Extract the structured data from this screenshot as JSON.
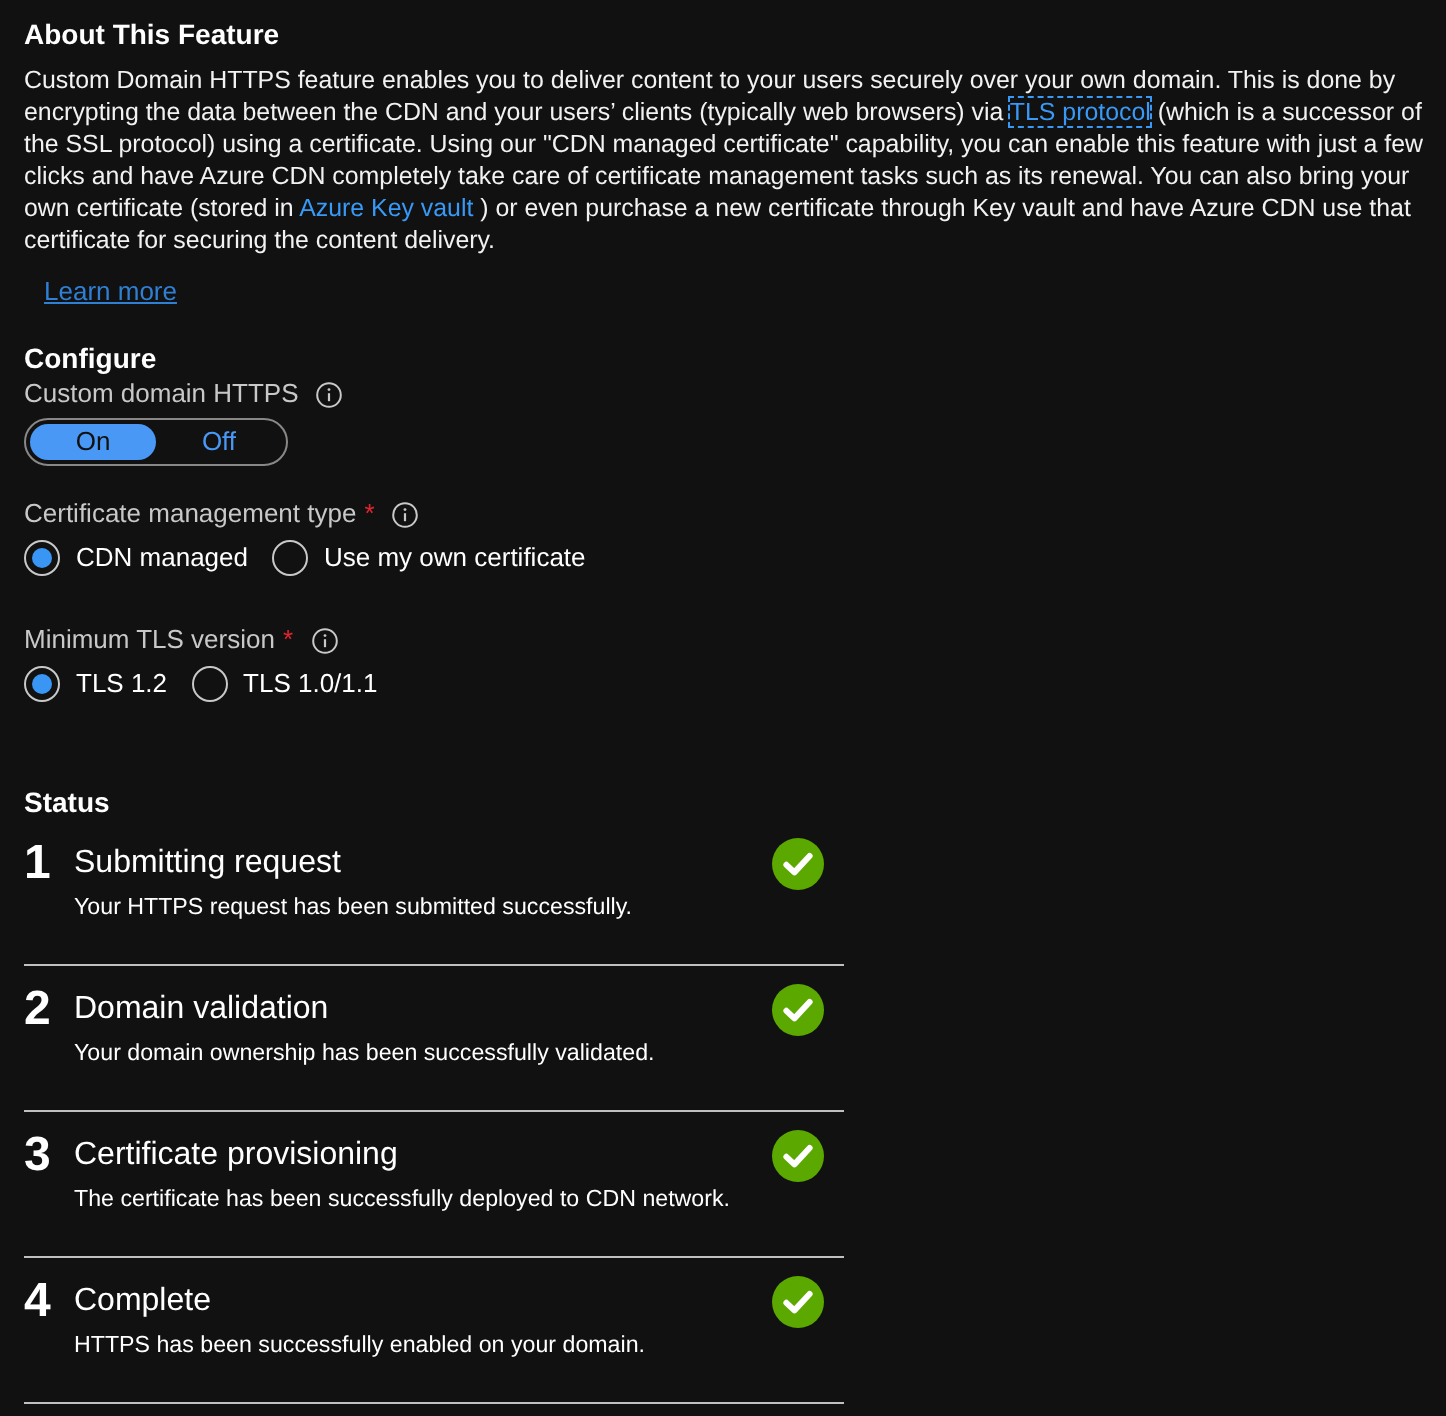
{
  "about": {
    "title": "About This Feature",
    "paragraph": [
      {
        "kind": "text",
        "text": "Custom Domain HTTPS feature enables you to deliver content to your users securely over your own domain. This is done by encrypting the data between the CDN and your users’ clients (typically web browsers) via "
      },
      {
        "kind": "link",
        "text": "TLS protocol",
        "focused": true
      },
      {
        "kind": "text",
        "text": " (which is a successor of the SSL protocol) using a certificate. Using our \"CDN managed certificate\" capability, you can enable this feature with just a few clicks and have Azure CDN completely take care of certificate management tasks such as its renewal. You can also bring your own certificate (stored in "
      },
      {
        "kind": "link",
        "text": "Azure Key vault",
        "focused": false
      },
      {
        "kind": "text",
        "text": " ) or even purchase a new certificate through Key vault and have Azure CDN use that certificate for securing the content delivery."
      }
    ],
    "learn_more": "Learn more"
  },
  "configure": {
    "title": "Configure",
    "fields": [
      {
        "kind": "toggle",
        "label": "Custom domain HTTPS",
        "info": true,
        "options": [
          {
            "label": "On",
            "selected": true
          },
          {
            "label": "Off",
            "selected": false
          }
        ]
      },
      {
        "kind": "radio",
        "label": "Certificate management type",
        "required_mark": "*",
        "info": true,
        "options": [
          {
            "label": "CDN managed",
            "selected": true
          },
          {
            "label": "Use my own certificate",
            "selected": false
          }
        ]
      },
      {
        "kind": "radio",
        "label": "Minimum TLS version",
        "required_mark": "*",
        "info": true,
        "options": [
          {
            "label": "TLS 1.2",
            "selected": true
          },
          {
            "label": "TLS 1.0/1.1",
            "selected": false
          }
        ]
      }
    ]
  },
  "status": {
    "title": "Status",
    "steps": [
      {
        "number": "1",
        "title": "Submitting request",
        "description": "Your HTTPS request has been submitted successfully.",
        "done": true
      },
      {
        "number": "2",
        "title": "Domain validation",
        "description": "Your domain ownership has been successfully validated.",
        "done": true
      },
      {
        "number": "3",
        "title": "Certificate provisioning",
        "description": "The certificate has been successfully deployed to CDN network.",
        "done": true
      },
      {
        "number": "4",
        "title": "Complete",
        "description": "HTTPS has been successfully enabled on your domain.",
        "done": true
      }
    ]
  }
}
